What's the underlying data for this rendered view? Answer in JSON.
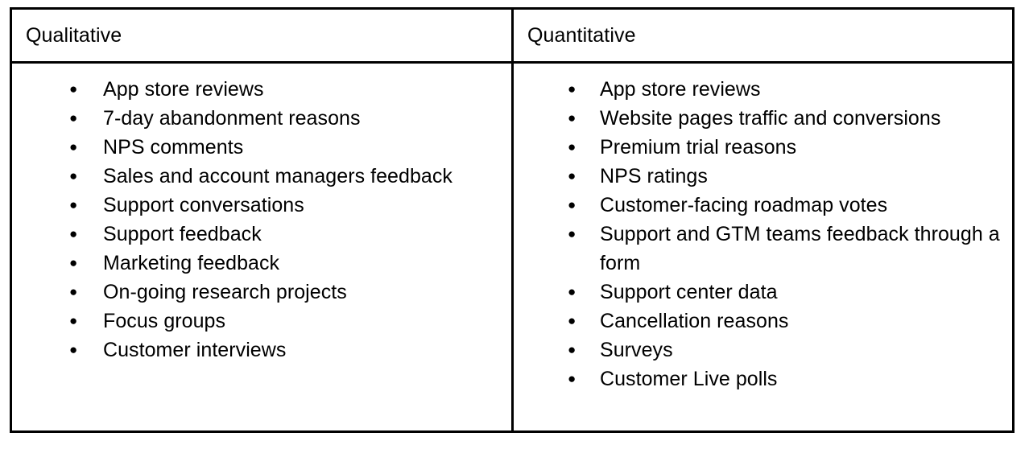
{
  "table": {
    "columns": [
      {
        "id": "qualitative",
        "header": "Qualitative",
        "items": [
          "App store reviews",
          "7-day abandonment reasons",
          "NPS comments",
          "Sales and account managers feedback",
          "Support conversations",
          "Support feedback",
          "Marketing feedback",
          "On-going research projects",
          "Focus groups",
          "Customer interviews"
        ]
      },
      {
        "id": "quantitative",
        "header": "Quantitative",
        "items": [
          "App store reviews",
          "Website pages traffic and conversions",
          "Premium trial reasons",
          "NPS ratings",
          "Customer-facing roadmap votes",
          "Support and GTM teams feedback through a form",
          "Support center data",
          "Cancellation reasons",
          "Surveys",
          "Customer Live polls"
        ]
      }
    ],
    "bullet_glyph": "●",
    "border_color": "#000000",
    "text_color": "#000000",
    "background_color": "#FFFFFF"
  }
}
